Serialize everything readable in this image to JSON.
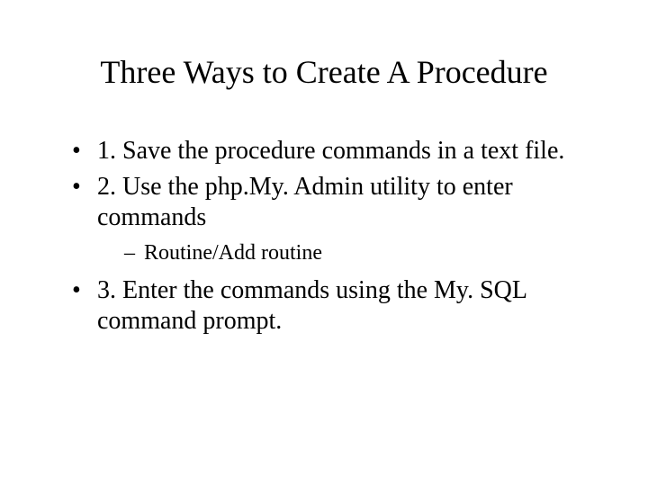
{
  "title": "Three Ways to Create A Procedure",
  "bullets": {
    "b1": "1. Save the procedure commands in a text file.",
    "b2": "2. Use the php.My. Admin utility to enter commands",
    "b2_sub1": "Routine/Add routine",
    "b3": "3. Enter the commands using the My. SQL command prompt."
  }
}
